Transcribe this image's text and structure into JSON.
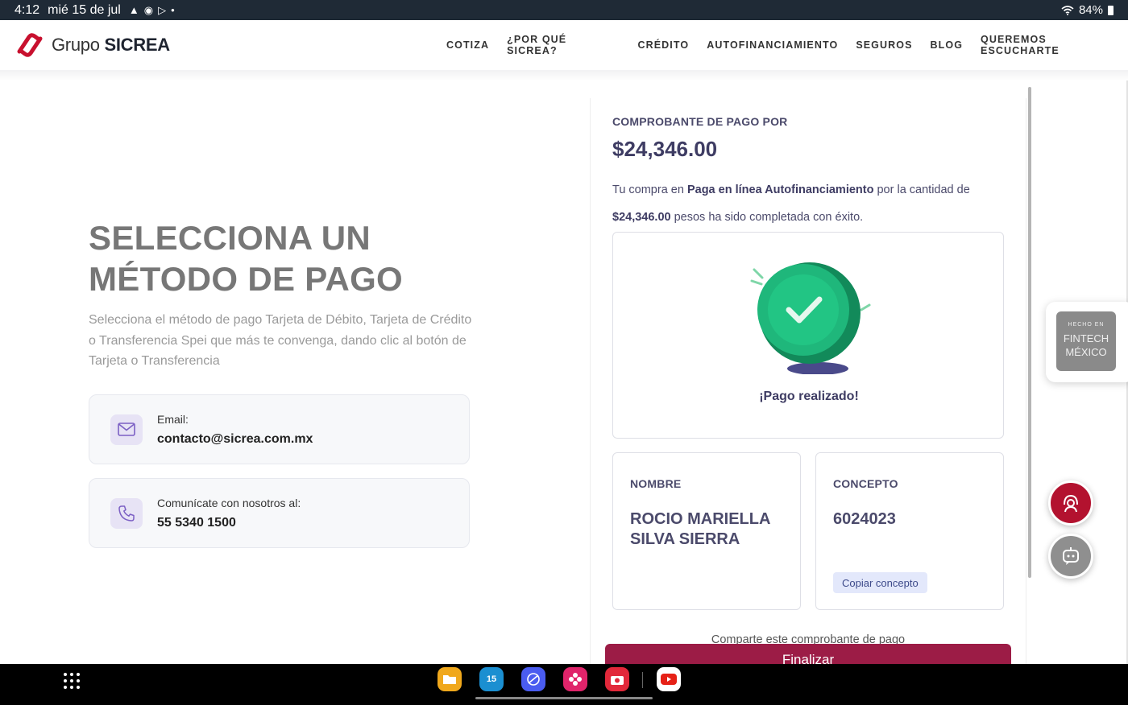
{
  "status_bar": {
    "time": "4:12",
    "date": "mié 15 de jul",
    "battery": "84%",
    "icons": [
      "warning-icon",
      "chrome-icon",
      "play-store-icon",
      "dot-icon",
      "wifi-icon",
      "battery-icon"
    ]
  },
  "header": {
    "logo_light": "Grupo ",
    "logo_bold": "SICREA",
    "nav": [
      "COTIZA",
      "¿POR QUÉ SICREA?",
      "CRÉDITO",
      "AUTOFINANCIAMIENTO",
      "SEGUROS",
      "BLOG",
      "QUEREMOS ESCUCHARTE"
    ]
  },
  "left": {
    "title_line1": "SELECCIONA UN",
    "title_line2": "MÉTODO DE PAGO",
    "description": "Selecciona el método de pago Tarjeta de Débito, Tarjeta de Crédito o Transferencia Spei que más te convenga, dando clic al botón de Tarjeta o Transferencia",
    "email_label": "Email:",
    "email_value": "contacto@sicrea.com.mx",
    "phone_label": "Comunícate con nosotros al:",
    "phone_value": "55 5340 1500"
  },
  "receipt": {
    "title": "COMPROBANTE DE PAGO POR",
    "amount": "$24,346.00",
    "line1_pre": "Tu compra en ",
    "line1_bold": "Paga en línea Autofinanciamiento",
    "line1_post": " por la cantidad de",
    "line2_bold": "$24,346.00",
    "line2_post": " pesos ha sido completada con éxito.",
    "success": "¡Pago realizado!",
    "name_label": "NOMBRE",
    "name_value_1": "ROCIO MARIELLA",
    "name_value_2": "SILVA SIERRA",
    "concept_label": "CONCEPTO",
    "concept_value": "6024023",
    "copy_button": "Copiar concepto",
    "share_text": "Comparte este comprobante de pago",
    "finish_button": "Finalizar"
  },
  "fintech_badge": {
    "line1": "HECHO EN",
    "line2": "FINTECH",
    "line3": "MÉXICO"
  },
  "colors": {
    "brand_red": "#b3122f",
    "finish_button": "#9c1c46",
    "receipt_text": "#3e3c63",
    "success_green": "#1fb77b"
  },
  "dock": {
    "calendar_day": "15"
  }
}
